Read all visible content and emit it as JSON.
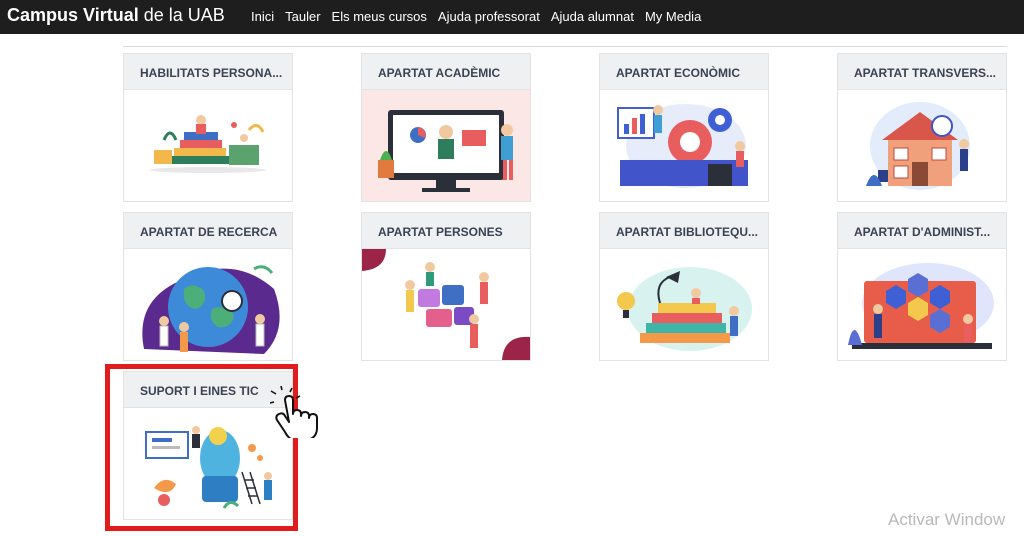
{
  "header": {
    "brand_bold": "Campus Virtual",
    "brand_rest": " de la UAB",
    "nav": [
      "Inici",
      "Tauler",
      "Els meus cursos",
      "Ajuda professorat",
      "Ajuda alumnat",
      "My Media"
    ]
  },
  "cards": [
    {
      "title": "HABILITATS PERSONA...",
      "image": "books-reading-illustration"
    },
    {
      "title": "APARTAT ACADÈMIC",
      "image": "online-teaching-illustration"
    },
    {
      "title": "APARTAT ECONÒMIC",
      "image": "finance-gears-illustration"
    },
    {
      "title": "APARTAT TRANSVERS...",
      "image": "house-people-illustration"
    },
    {
      "title": "APARTAT DE RECERCA",
      "image": "globe-research-illustration"
    },
    {
      "title": "APARTAT PERSONES",
      "image": "puzzle-team-illustration"
    },
    {
      "title": "APARTAT BIBLIOTEQU...",
      "image": "library-books-illustration"
    },
    {
      "title": "APARTAT D'ADMINIST...",
      "image": "admin-laptop-illustration"
    },
    {
      "title": "SUPORT I EINES TIC",
      "image": "tech-support-illustration"
    }
  ],
  "watermark": "Activar Window",
  "colors": {
    "header_bg": "#1e1e1e",
    "card_head_bg": "#eff0f2",
    "highlight": "#e21c1c"
  }
}
